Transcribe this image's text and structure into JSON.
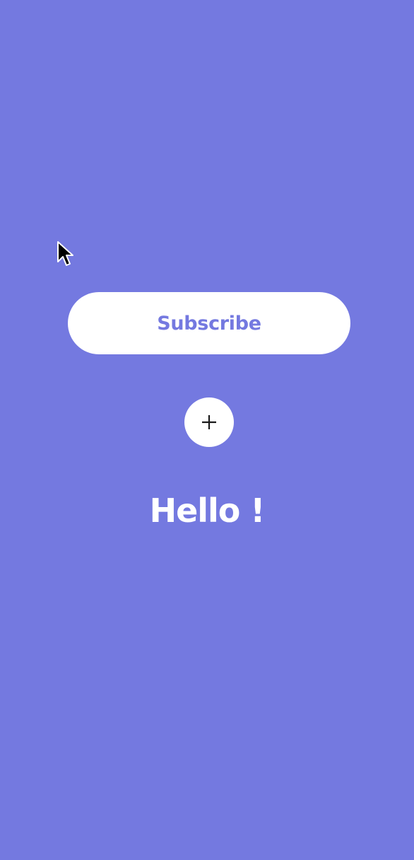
{
  "colors": {
    "background": "#7479e0",
    "button_background": "#ffffff",
    "button_text": "#7479e0",
    "icon": "#1a1a1a",
    "greeting_text": "#ffffff"
  },
  "cursor": {
    "icon": "mouse-pointer-icon"
  },
  "subscribe_button": {
    "label": "Subscribe"
  },
  "add_button": {
    "icon": "plus-icon"
  },
  "greeting": {
    "text": "Hello !"
  }
}
